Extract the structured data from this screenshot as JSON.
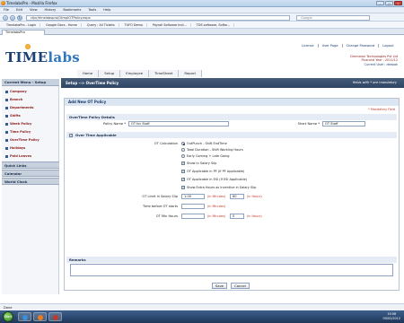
{
  "browser": {
    "window_title": "TimelabsPro - Mozilla Firefox",
    "menu": [
      "File",
      "Edit",
      "View",
      "History",
      "Bookmarks",
      "Tools",
      "Help"
    ],
    "url": "cfpc/timelabspro/OtmplOTPolicy.aspx",
    "search_placeholder": "Google",
    "bookmarks": [
      "TimelabsPro - Login",
      "Google Docs - Home",
      "Query : All Tickets",
      "TUFO Demo",
      "Payroll Software Indi...",
      "TDS software, Softw..."
    ],
    "tab": "TimelabsPro",
    "status": "Done"
  },
  "app": {
    "logo_a": "TIME",
    "logo_b": "labs",
    "top_links": [
      "License",
      "User Page",
      "Change Password",
      "Logout"
    ],
    "company": "Cimmaron Technologies Pvt Ltd",
    "financial_year": "Financial Year : 2011/12",
    "current_user": "Current User : deepak",
    "main_nav": [
      "Home",
      "Setup",
      "Employee",
      "TimeSheet",
      "Report"
    ],
    "breadcrumb": "Setup --> OverTime Policy",
    "header_note": "fields with * are mandatory"
  },
  "sidebar": {
    "header": "Current Menu - Setup",
    "items": [
      "Company",
      "Branch",
      "Departments",
      "Shifts",
      "Week Policy",
      "Time Policy",
      "OverTime Policy",
      "Holidays",
      "Paid Leaves"
    ],
    "sections": [
      "Quick Links",
      "Calendar",
      "World Clock"
    ]
  },
  "form": {
    "title": "Add New OT Policy",
    "mandatory_note": "* Mandatory Field",
    "sec_details": "OverTime Policy Details",
    "policy_name_label": "Policy Name *",
    "policy_name_value": "OT for Staff",
    "short_name_label": "Short Name *",
    "short_name_value": "OT Staff",
    "sec_overtime": "Over Time Applicable",
    "ot_calc_label": "OT Calculation",
    "ot_calc_options": [
      "OutPunch - Shift EndTime",
      "Total Duration - Shift Working Hours",
      "Early Coming + Late Going"
    ],
    "checkboxes": [
      "Show in Salary Slip",
      "OT Applicable in PF (If PF Applicable)",
      "OT Applicable in ESI (If ESI Applicable)",
      "Show Extra Hours as Incentive in Salary Slip"
    ],
    "ot_limit_label": "OT Limit in Salary Slip",
    "ot_limit_value": "1:00",
    "ot_limit_hint": "(in Minutes)",
    "ot_limit_value2": "60",
    "ot_limit_hint2": "(in Hours)",
    "time_before_label": "Time before OT starts",
    "time_before_hint": "(in Minutes)",
    "ot_hours_label": "OT Min Hours",
    "ot_hours_hint": "(in Minutes)",
    "ot_hours_value2": "0",
    "ot_hours_hint2": "(in Hours)",
    "sec_remarks": "Remarks",
    "save": "Save",
    "cancel": "Cancel"
  },
  "taskbar": {
    "start": "Start",
    "time": "19:08",
    "date": "09/02/2012"
  }
}
